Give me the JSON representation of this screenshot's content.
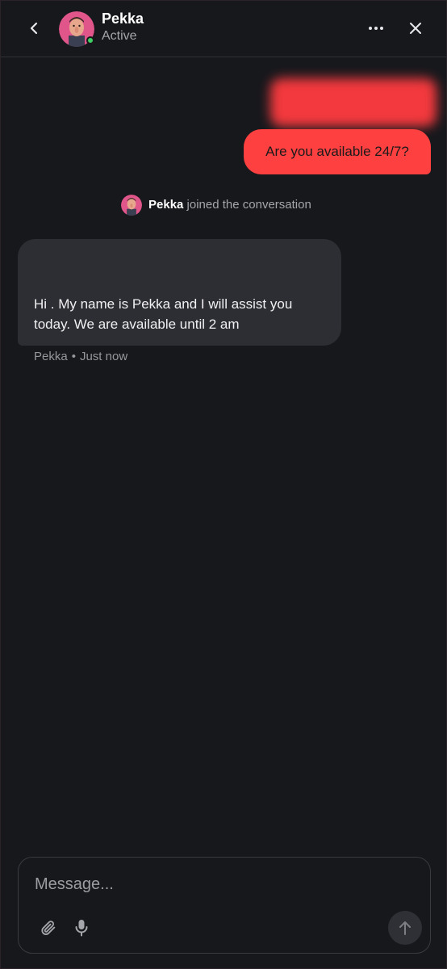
{
  "header": {
    "agent_name": "Pekka",
    "agent_status": "Active",
    "back_icon": "chevron-left-icon",
    "more_icon": "more-horizontal-icon",
    "close_icon": "close-icon"
  },
  "conversation": {
    "user_message": "Are you available 24/7?",
    "joined": {
      "name": "Pekka",
      "text": "joined the conversation"
    },
    "agent_message": "Hi . My name is Pekka and I will assist you today. We are available until 2 am",
    "agent_meta": {
      "author": "Pekka",
      "separator": "•",
      "time": "Just now"
    }
  },
  "composer": {
    "placeholder": "Message...",
    "attach_icon": "paperclip-icon",
    "mic_icon": "microphone-icon",
    "send_icon": "arrow-up-icon"
  },
  "colors": {
    "background": "#17181c",
    "user_bubble": "#ff4040",
    "agent_bubble": "#2d2e33",
    "status_active": "#3fcf62"
  }
}
